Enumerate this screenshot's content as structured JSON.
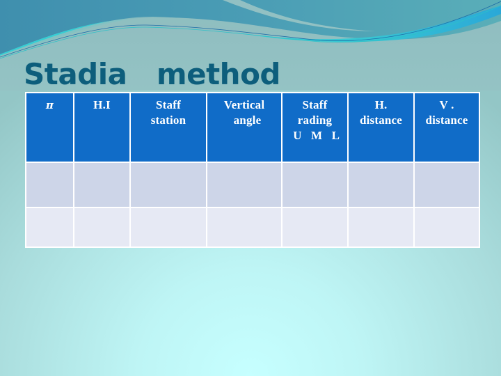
{
  "slide": {
    "title": "Stadia   method",
    "colors": {
      "title": "#0d5e7c",
      "header_fill": "#106cc8",
      "header_text": "#ffffff",
      "row_band_1": "#cdd5e8",
      "row_band_2": "#e6e9f4",
      "table_border": "#ffffff",
      "background_light": "#c6ffff",
      "background_dark": "#93c6c6"
    }
  },
  "table": {
    "headers": [
      {
        "key": "pi",
        "lines": [
          "π"
        ]
      },
      {
        "key": "hi",
        "lines": [
          "H.I"
        ]
      },
      {
        "key": "staff-station",
        "lines": [
          "Staff",
          "station"
        ]
      },
      {
        "key": "vertical-angle",
        "lines": [
          "Vertical",
          "  angle"
        ]
      },
      {
        "key": "staff-reading",
        "lines": [
          "Staff",
          "rading",
          " U   M   L"
        ]
      },
      {
        "key": "h-distance",
        "lines": [
          "H.",
          "distance"
        ]
      },
      {
        "key": "v-distance",
        "lines": [
          "V .",
          "distance"
        ]
      }
    ],
    "rows": [
      [
        "",
        "",
        "",
        "",
        "",
        "",
        ""
      ],
      [
        "",
        "",
        "",
        "",
        "",
        "",
        ""
      ]
    ]
  }
}
